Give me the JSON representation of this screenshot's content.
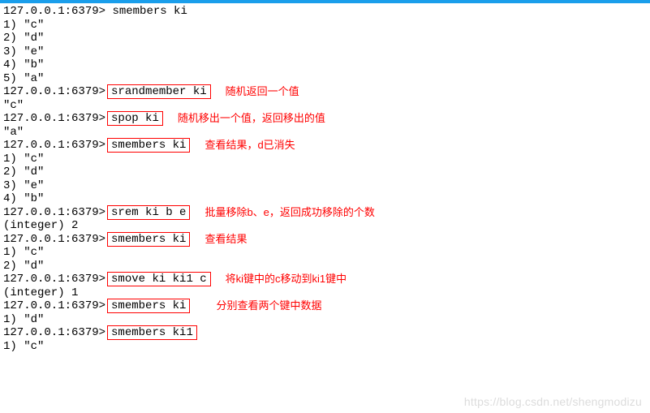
{
  "prompt": "127.0.0.1:6379>",
  "lines": {
    "cmd_smembers_ki_1": "smembers ki",
    "out1": [
      "1) \"c\"",
      "2) \"d\"",
      "3) \"e\"",
      "4) \"b\"",
      "5) \"a\""
    ],
    "cmd_srandmember": "srandmember ki",
    "note_srandmember": "随机返回一个值",
    "out_srandmember": "\"c\"",
    "cmd_spop": "spop ki",
    "note_spop": "随机移出一个值，返回移出的值",
    "out_spop": "\"a\"",
    "cmd_smembers_ki_2": "smembers ki",
    "note_smembers_2": "查看结果，d已消失",
    "out2": [
      "1) \"c\"",
      "2) \"d\"",
      "3) \"e\"",
      "4) \"b\""
    ],
    "cmd_srem": "srem ki b e",
    "note_srem": "批量移除b、e，返回成功移除的个数",
    "out_srem": "(integer) 2",
    "cmd_smembers_ki_3": "smembers ki",
    "note_smembers_3": "查看结果",
    "out3": [
      "1) \"c\"",
      "2) \"d\""
    ],
    "cmd_smove": "smove ki ki1 c",
    "note_smove": "将ki键中的c移动到ki1键中",
    "out_smove": "(integer) 1",
    "cmd_smembers_ki_4": "smembers ki",
    "out4": [
      "1) \"d\""
    ],
    "cmd_smembers_ki1": "smembers ki1",
    "note_both": "分别查看两个键中数据",
    "out5": [
      "1) \"c\""
    ]
  },
  "watermark": "https://blog.csdn.net/shengmodizu"
}
